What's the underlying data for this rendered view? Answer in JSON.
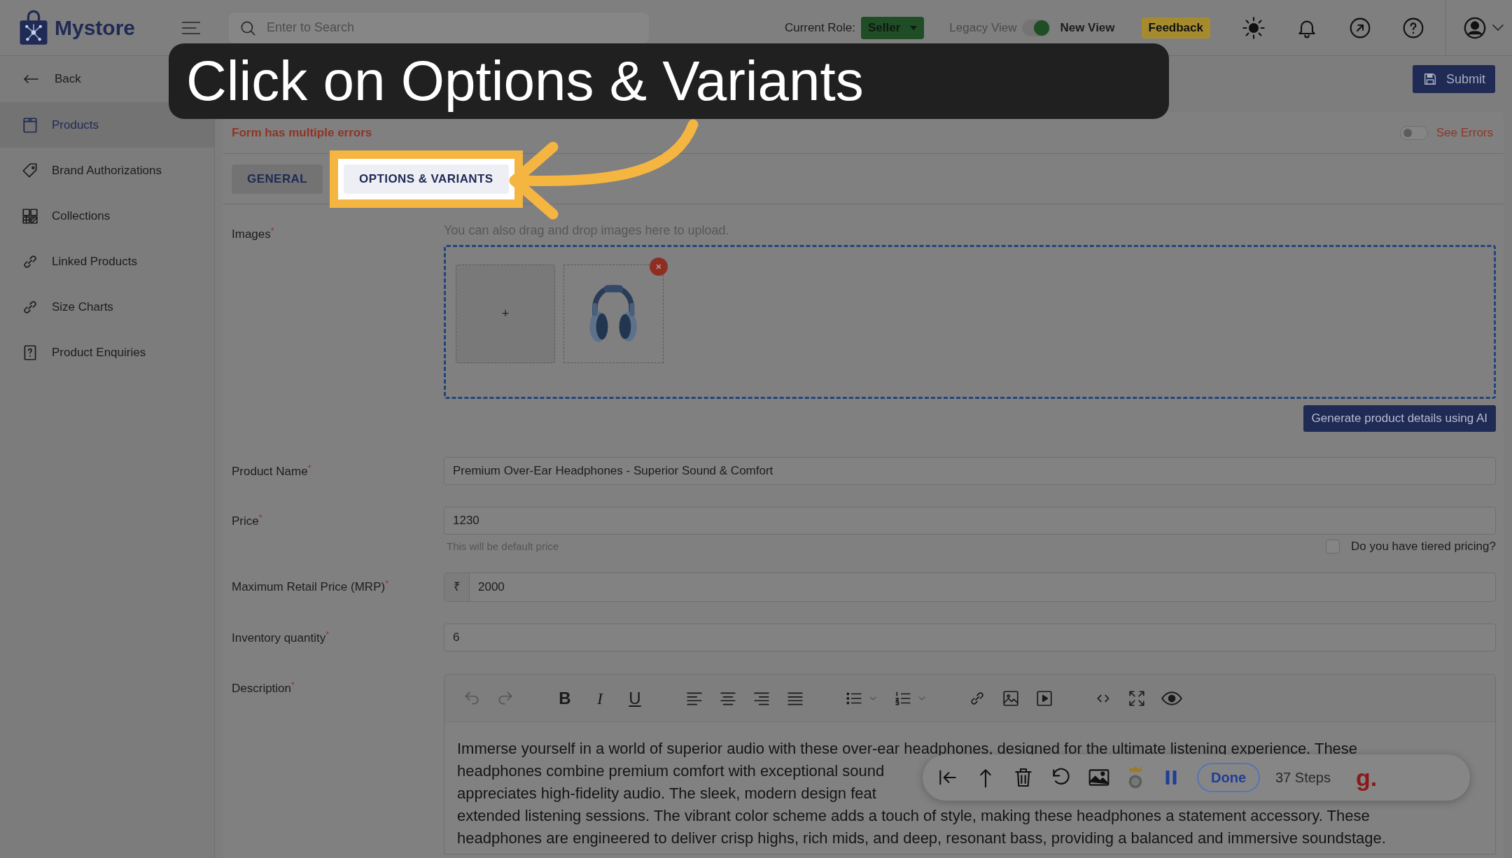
{
  "topbar": {
    "logo": "Mystore",
    "search": {
      "placeholder": "Enter to Search"
    },
    "role_label": "Current Role:",
    "role": "Seller",
    "view_toggle": {
      "left": "Legacy View",
      "right": "New View",
      "on": true
    },
    "feedback": "Feedback"
  },
  "sidebar": {
    "back": "Back",
    "items": [
      {
        "label": "Products",
        "selected": true
      },
      {
        "label": "Brand Authorizations",
        "selected": false
      },
      {
        "label": "Collections",
        "selected": false
      },
      {
        "label": "Linked Products",
        "selected": false
      },
      {
        "label": "Size Charts",
        "selected": false
      },
      {
        "label": "Product Enquiries",
        "selected": false
      }
    ]
  },
  "submit": "Submit",
  "errors": {
    "message": "Form has multiple errors",
    "see_errors": "See Errors",
    "on": false
  },
  "tabs": [
    {
      "label": "GENERAL",
      "selected": true,
      "highlighted": false
    },
    {
      "label": "OPTIONS & VARIANTS",
      "selected": false,
      "highlighted": true
    }
  ],
  "images": {
    "label": "Images$^{*}$",
    "hint": "You can also drag and drop images here to upload.",
    "add": "+",
    "remove": "×"
  },
  "generate_button": "Generate product details using AI",
  "fields": [
    {
      "kind": "text",
      "label": "Product Name$^{*}$",
      "value": "Premium Over-Ear Headphones - Superior Sound & Comfort"
    },
    {
      "kind": "text",
      "label": "Price$^{*}$",
      "value": "1230",
      "hint": "This will be default price",
      "option": {
        "label": "Do you have tiered pricing?",
        "checked": false
      }
    },
    {
      "kind": "currency",
      "label": "Maximum Retail Price (MRP)$^{*}$",
      "prefix": "₹",
      "value": "2000"
    },
    {
      "kind": "text",
      "label": "Inventory quantity$^{*}$",
      "value": "6"
    }
  ],
  "description": {
    "label": "Description$^{*}$",
    "format_buttons": [
      "B",
      "I",
      "U"
    ],
    "lines": [
      "Immerse yourself in a world of superior audio with these over-ear headphones, designed for the ultimate listening experience. These",
      "headphones combine premium comfort with exceptional sound",
      "appreciates high-fidelity audio. The sleek, modern design feat",
      "extended listening sessions. The vibrant color scheme adds a touch of style, making these headphones a statement accessory. These",
      "headphones are engineered to deliver crisp highs, rich mids, and deep, resonant bass, providing a balanced and immersive soundstage."
    ]
  },
  "callout": {
    "text": "Click on Options & Variants"
  },
  "recorder": {
    "done": "Done",
    "steps": "37 Steps",
    "logo": "g."
  }
}
